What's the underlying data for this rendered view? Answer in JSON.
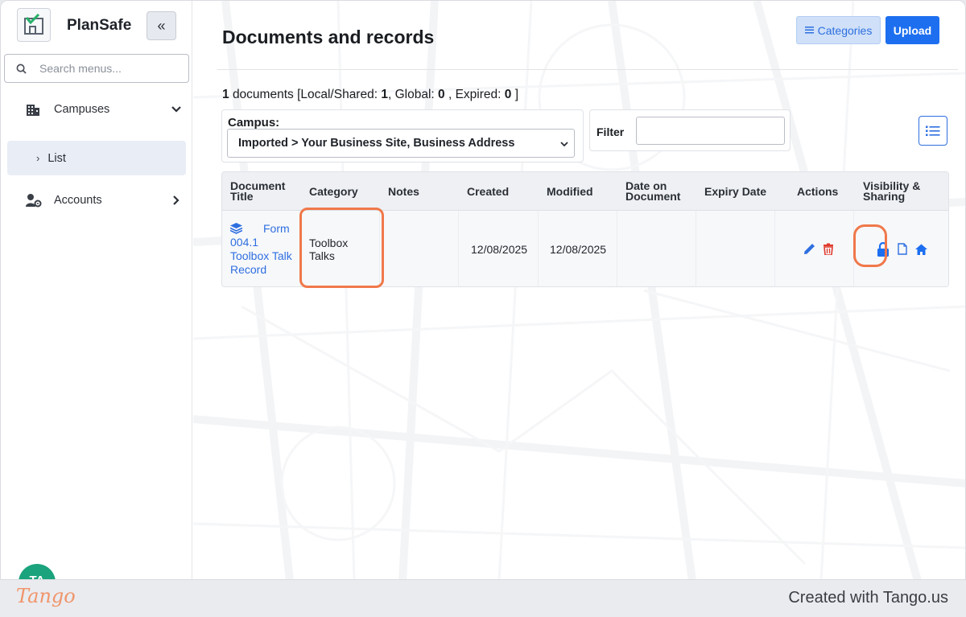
{
  "app": {
    "brand": "PlanSafe",
    "accent": "#1d6ff0",
    "highlight_color": "#f0784a"
  },
  "sidebar": {
    "search_placeholder": "Search menus...",
    "items": [
      {
        "label": "Campuses",
        "icon": "building-icon",
        "expanded": true
      },
      {
        "label": "Accounts",
        "icon": "users-cog-icon",
        "expanded": false
      }
    ],
    "sub_items": [
      {
        "label": "List",
        "active": true
      }
    ],
    "avatar_initials": "TA"
  },
  "header": {
    "title": "Documents and records",
    "categories_label": "Categories",
    "upload_label": "Upload"
  },
  "summary": {
    "count": "1",
    "text_documents": "documents [Local/Shared:",
    "local_shared": "1",
    "text_global": ", Global:",
    "global": "0",
    "text_expired": ", Expired:",
    "expired": "0",
    "text_end": "]"
  },
  "filters": {
    "campus_label": "Campus:",
    "campus_value": "Imported > Your Business Site, Business Address",
    "filter_label": "Filter",
    "filter_value": ""
  },
  "table": {
    "columns": [
      "Document Title",
      "Category",
      "Notes",
      "Created",
      "Modified",
      "Date on Document",
      "Expiry Date",
      "Actions",
      "Visibility & Sharing"
    ],
    "rows": [
      {
        "title_line1": "Form",
        "title_line2": "004.1",
        "title_line3": "Toolbox Talk",
        "title_line4": "Record",
        "category_line1": "Toolbox",
        "category_line2": "Talks",
        "notes": "",
        "created": "12/08/2025",
        "modified": "12/08/2025",
        "date_on_document": "",
        "expiry_date": ""
      }
    ]
  },
  "footer": {
    "logo": "Tango",
    "credit": "Created with Tango.us"
  }
}
